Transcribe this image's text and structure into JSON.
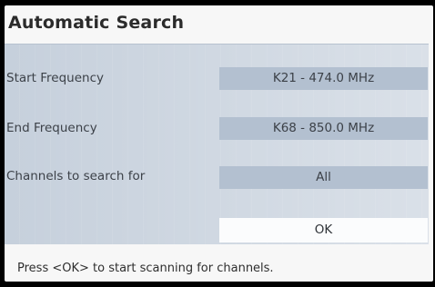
{
  "dialog": {
    "title": "Automatic Search"
  },
  "settings": [
    {
      "label": "Start Frequency",
      "value": "K21 - 474.0 MHz"
    },
    {
      "label": "End Frequency",
      "value": "K68 - 850.0 MHz"
    },
    {
      "label": "Channels to search for",
      "value": "All"
    }
  ],
  "ok_button": {
    "label": "OK"
  },
  "hint": "Press <OK> to start scanning for channels."
}
